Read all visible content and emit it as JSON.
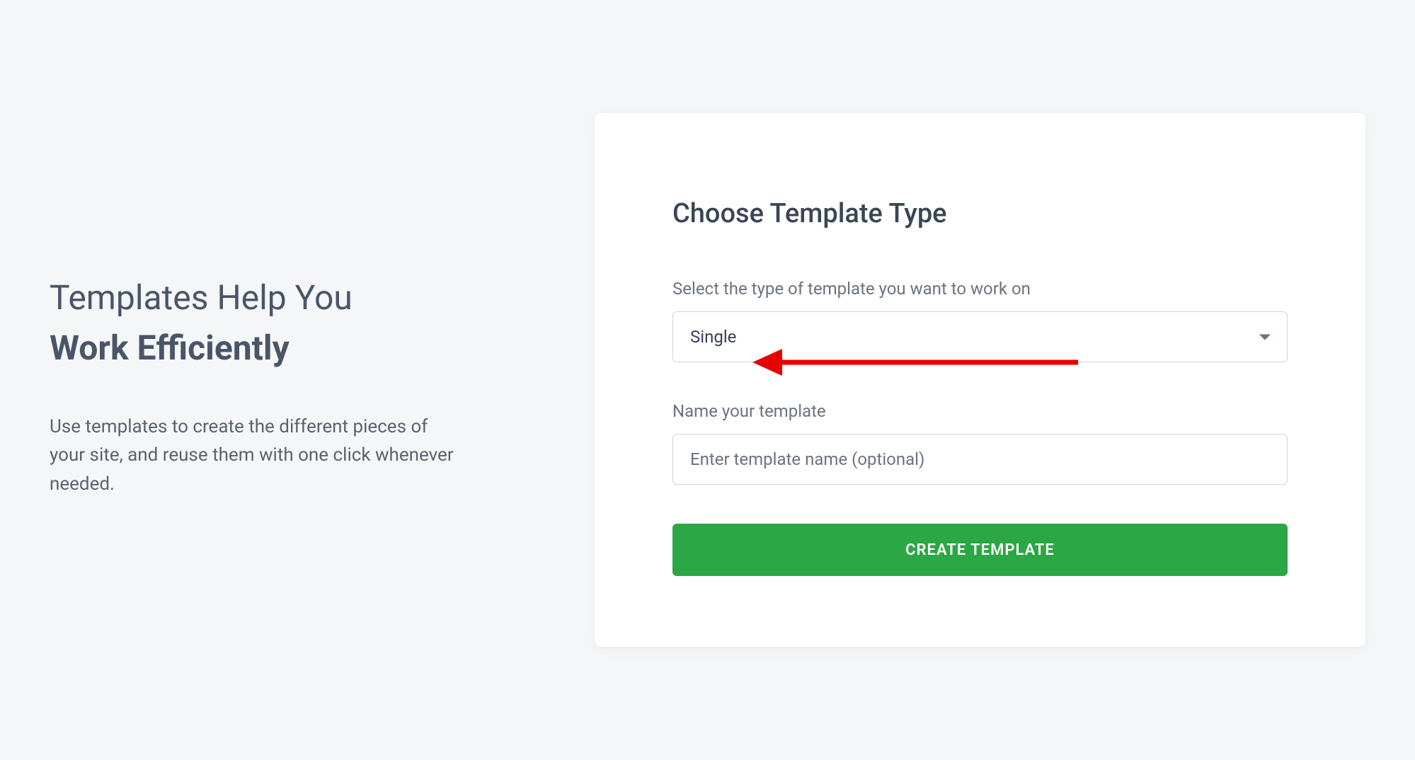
{
  "left": {
    "heading_line1": "Templates Help You",
    "heading_line2": "Work Efficiently",
    "description": "Use templates to create the different pieces of your site, and reuse them with one click whenever needed."
  },
  "card": {
    "title": "Choose Template Type",
    "type_field": {
      "label": "Select the type of template you want to work on",
      "selected": "Single"
    },
    "name_field": {
      "label": "Name your template",
      "placeholder": "Enter template name (optional)",
      "value": ""
    },
    "submit_label": "CREATE TEMPLATE"
  },
  "annotation": {
    "arrow_color": "#e60000"
  }
}
